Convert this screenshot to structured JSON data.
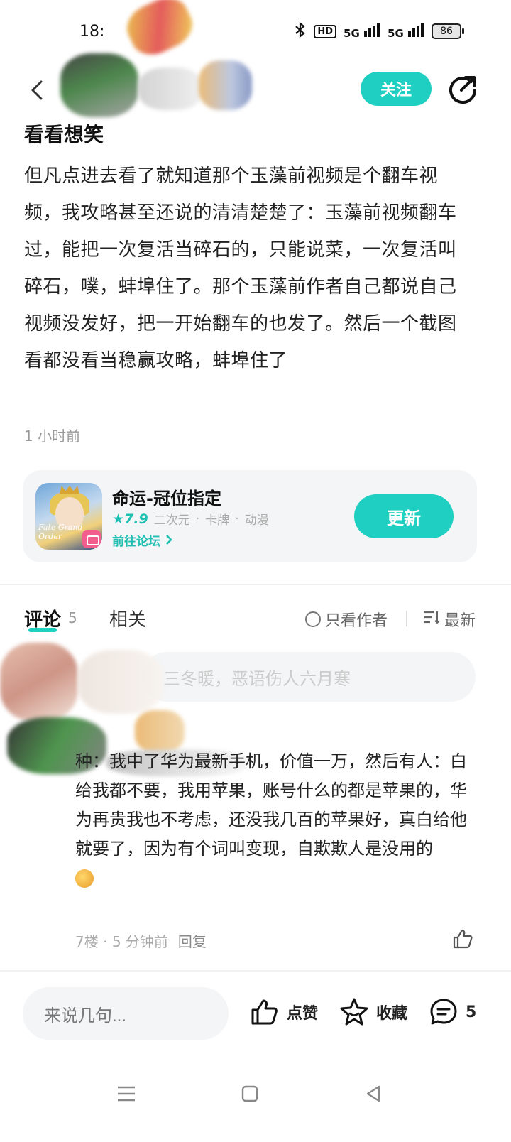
{
  "status_bar": {
    "time": "18:",
    "network_1": "5G",
    "network_2": "5G",
    "hd_label": "HD",
    "battery": "86"
  },
  "header": {
    "follow_label": "关注"
  },
  "post": {
    "title": "看看想笑",
    "body": "但凡点进去看了就知道那个玉藻前视频是个翻车视频，我攻略甚至还说的清清楚楚了：玉藻前视频翻车过，能把一次复活当碎石的，只能说菜，一次复活叫碎石，噗，蚌埠住了。那个玉藻前作者自己都说自己视频没发好，把一开始翻车的也发了。然后一个截图看都没看当稳赢攻略，蚌埠住了",
    "time": "1 小时前"
  },
  "game_card": {
    "name": "命运-冠位指定",
    "rating": "7.9",
    "tags": [
      "二次元",
      "卡牌",
      "动漫"
    ],
    "forum_link": "前往论坛",
    "update_label": "更新",
    "icon_text": "Fate Grand Order"
  },
  "tabs": {
    "comments_label": "评论",
    "comments_count": "5",
    "related_label": "相关",
    "only_author_label": "只看作者",
    "sort_label": "最新"
  },
  "comment_box": {
    "placeholder": "三冬暖，恶语伤人六月寒"
  },
  "comment": {
    "body": "种：我中了华为最新手机，价值一万，然后有人：白给我都不要，我用苹果，账号什么的都是苹果的，华为再贵我也不考虑，还没我几百的苹果好，真白给他就要了，因为有个词叫变现，自欺欺人是没用的",
    "floor": "7楼",
    "time": "5 分钟前",
    "reply_label": "回复"
  },
  "bottom_bar": {
    "input_placeholder": "来说几句...",
    "like_label": "点赞",
    "collect_label": "收藏",
    "comment_count": "5"
  },
  "colors": {
    "accent": "#1fcfc1",
    "text_primary": "#222222",
    "text_secondary": "#999999",
    "card_bg": "#f3f5f6"
  }
}
